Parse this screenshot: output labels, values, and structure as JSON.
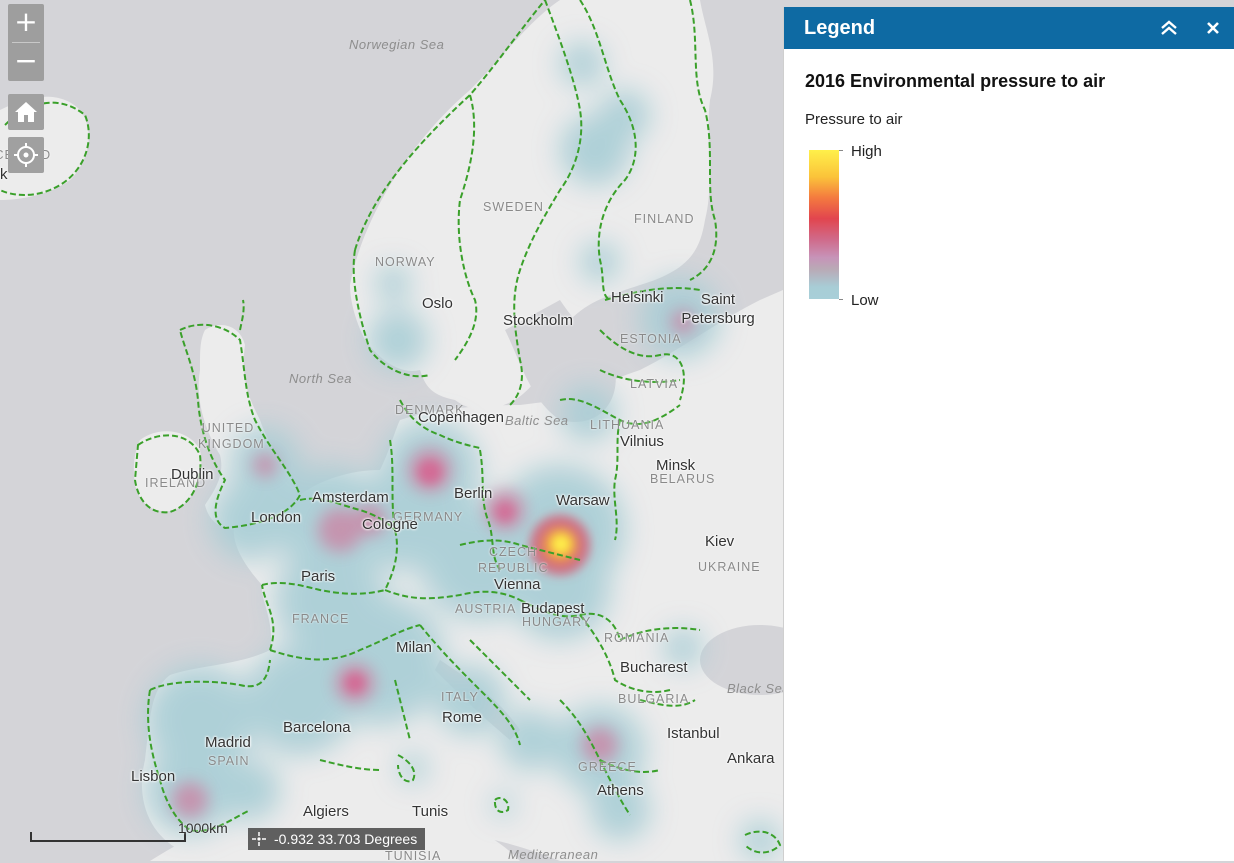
{
  "map": {
    "seas": [
      "Norwegian Sea",
      "North Sea",
      "Baltic Sea",
      "Black Sea",
      "Mediterranean"
    ],
    "countries": [
      "ICELAND",
      "SWEDEN",
      "FINLAND",
      "NORWAY",
      "ESTONIA",
      "LATVIA",
      "DENMARK",
      "LITHUANIA",
      "UNITED KINGDOM",
      "IRELAND",
      "BELARUS",
      "GERMANY",
      "CZECH REPUBLIC",
      "UKRAINE",
      "FRANCE",
      "AUSTRIA",
      "HUNGARY",
      "ROMANIA",
      "ITALY",
      "BULGARIA",
      "SPAIN",
      "GREECE",
      "TUNISIA"
    ],
    "cities": [
      "Oslo",
      "Stockholm",
      "Helsinki",
      "Saint Petersburg",
      "Copenhagen",
      "Vilnius",
      "Minsk",
      "Dublin",
      "London",
      "Amsterdam",
      "Berlin",
      "Warsaw",
      "Cologne",
      "Paris",
      "Kiev",
      "Vienna",
      "Budapest",
      "Milan",
      "Bucharest",
      "Barcelona",
      "Rome",
      "Istanbul",
      "Madrid",
      "Ankara",
      "Lisbon",
      "Algiers",
      "Tunis",
      "Athens"
    ],
    "partial_label": "k",
    "scale_label": "1000km",
    "coordinates": "-0.932 33.703 Degrees"
  },
  "controls": {
    "zoom_in": "+",
    "zoom_out": "−",
    "home_icon": "home-icon",
    "locate_icon": "locate-icon"
  },
  "legend": {
    "header": "Legend",
    "collapse_icon": "double-chevron-up-icon",
    "close_icon": "close-icon",
    "layer_title": "2016 Environmental pressure to air",
    "field": "Pressure to air",
    "high": "High",
    "low": "Low",
    "ramp_colors": [
      "#fff04a",
      "#f47a3f",
      "#e2454e",
      "#c793b8",
      "#a8cfd8"
    ],
    "header_color": "#0e6aa3"
  }
}
